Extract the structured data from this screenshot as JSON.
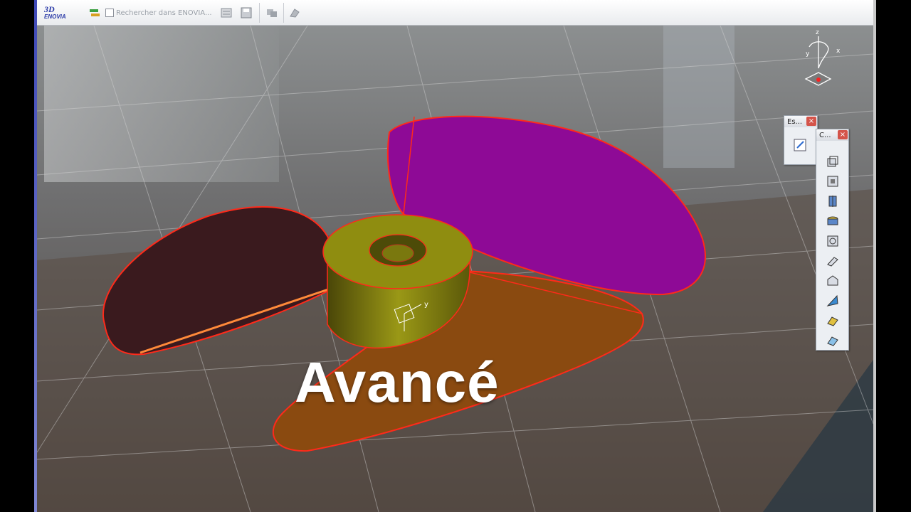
{
  "toolbar": {
    "logo_ds": "3D",
    "logo_enovia": "ENOVIA",
    "search_placeholder": "Rechercher dans ENOVIA..."
  },
  "overlay_text": "Avancé",
  "panels": {
    "sketcher": {
      "title": "Es..."
    },
    "commands": {
      "title": "C..."
    }
  },
  "compass": {
    "z": "z",
    "x": "x",
    "y": "y"
  },
  "part_axis": {
    "y": "y"
  },
  "colors": {
    "blade_purple": "#8e0a96",
    "blade_dark": "#3a1a1e",
    "blade_orange": "#8a4a10",
    "hub": "#8f8d10",
    "edge": "#ff2a1a"
  }
}
